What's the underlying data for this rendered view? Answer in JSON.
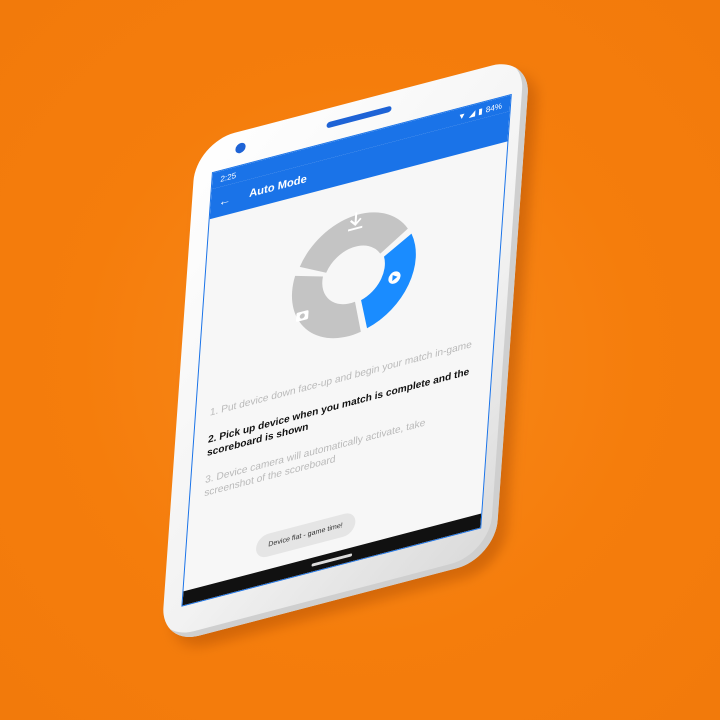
{
  "status_bar": {
    "time": "2:25",
    "battery": "84%"
  },
  "app_bar": {
    "title": "Auto Mode",
    "back_icon": "arrow-left-icon"
  },
  "donut": {
    "active_segment": "play",
    "icons": [
      "download-icon",
      "camera-icon",
      "play-icon"
    ],
    "colors": {
      "inactive": "#c4c4c4",
      "active": "#1a8cff"
    }
  },
  "steps": [
    {
      "text": "1. Put device down face-up and begin your match in-game",
      "state": "inactive"
    },
    {
      "text": "2. Pick up device when you match is complete and the scoreboard is shown",
      "state": "active"
    },
    {
      "text": "3. Device camera will automatically activate, take screenshot of the scoreboard",
      "state": "inactive"
    }
  ],
  "toast": "Device flat - game time!",
  "colors": {
    "background": "#f57d0c",
    "accent": "#1a73e8"
  }
}
